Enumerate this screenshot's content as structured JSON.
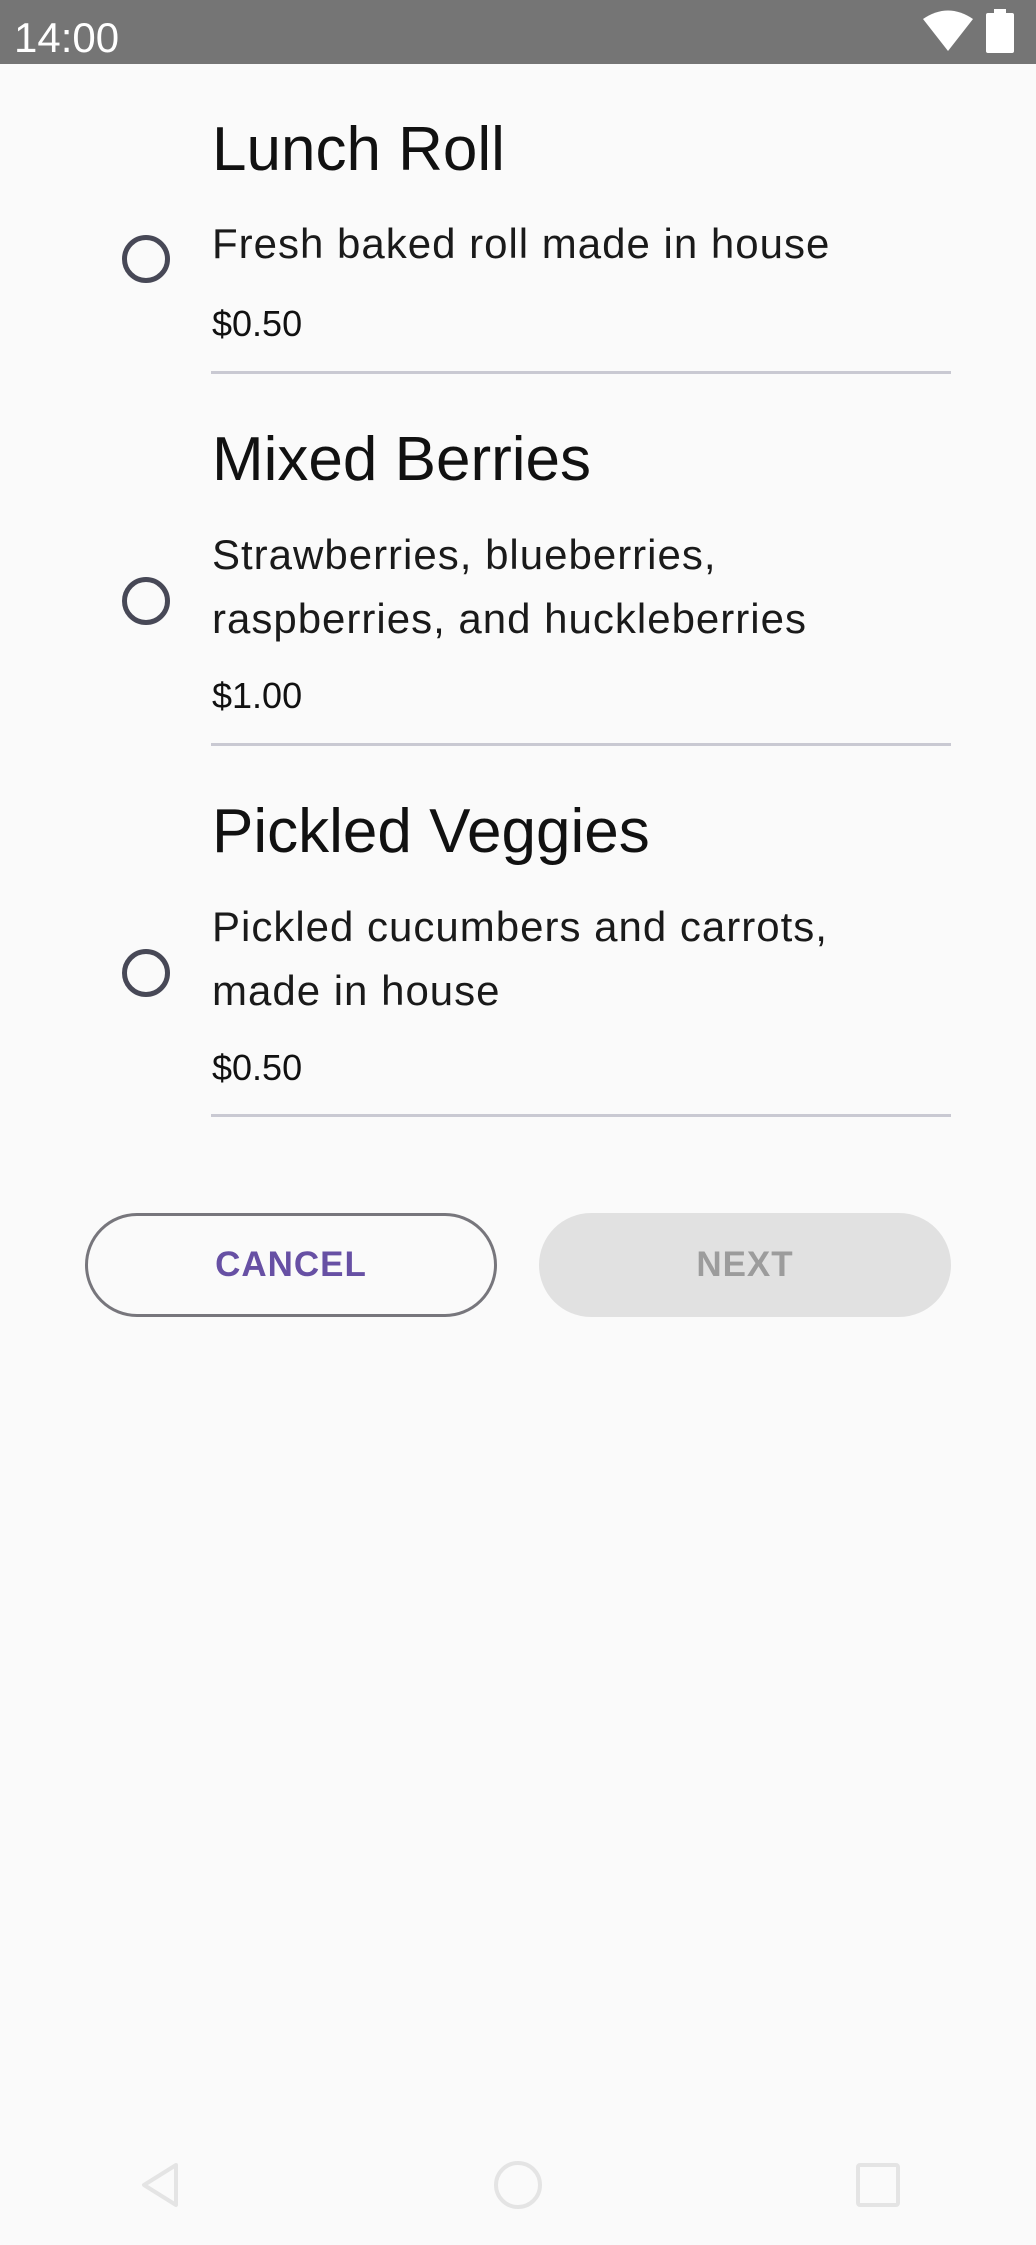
{
  "status_bar": {
    "time": "14:00",
    "icons": [
      "wifi-icon",
      "battery-icon"
    ]
  },
  "menu_items": [
    {
      "title": "Lunch Roll",
      "description": "Fresh baked roll made in house",
      "price": "$0.50"
    },
    {
      "title": "Mixed Berries",
      "description": "Strawberries, blueberries, raspberries, and huckleberries",
      "price": "$1.00"
    },
    {
      "title": "Pickled Veggies",
      "description": "Pickled cucumbers and carrots, made in house",
      "price": "$0.50"
    }
  ],
  "actions": {
    "cancel_label": "CANCEL",
    "next_label": "NEXT"
  },
  "nav": {
    "icons": [
      "back-icon",
      "home-icon",
      "recents-icon"
    ]
  },
  "colors": {
    "status_bar": "#757575",
    "background": "#fafafa",
    "accent": "#6750a4",
    "radio": "#474856",
    "divider": "#c9c9d2",
    "disabled_button": "#e1e1e1"
  }
}
